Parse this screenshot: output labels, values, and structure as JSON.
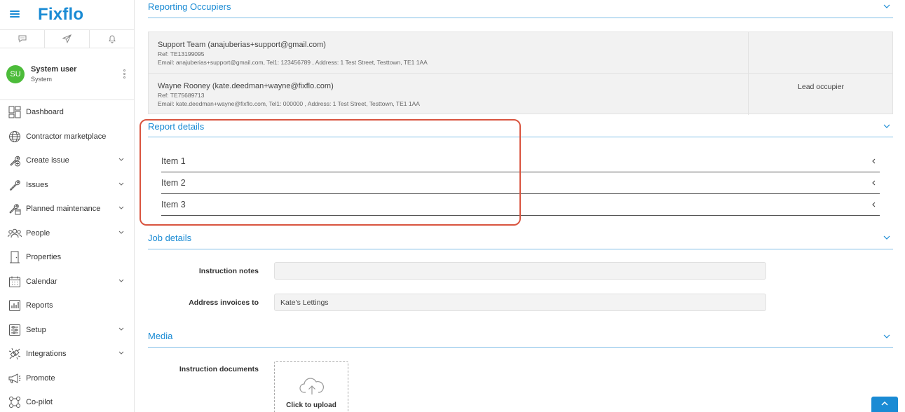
{
  "app": {
    "logo": "Fixflo"
  },
  "sidebar": {
    "top_icons": [
      "chat-icon",
      "send-icon",
      "bell-icon"
    ],
    "user": {
      "initials": "SU",
      "name": "System user",
      "role": "System",
      "avatar_color": "#4cbc3a"
    },
    "nav": [
      {
        "label": "Dashboard",
        "icon": "dashboard-icon",
        "has_chevron": false
      },
      {
        "label": "Contractor marketplace",
        "icon": "globe-icon",
        "has_chevron": false
      },
      {
        "label": "Create issue",
        "icon": "wrench-plus-icon",
        "has_chevron": true
      },
      {
        "label": "Issues",
        "icon": "wrench-icon",
        "has_chevron": true
      },
      {
        "label": "Planned maintenance",
        "icon": "calendar-wrench-icon",
        "has_chevron": true
      },
      {
        "label": "People",
        "icon": "people-icon",
        "has_chevron": true
      },
      {
        "label": "Properties",
        "icon": "door-icon",
        "has_chevron": false
      },
      {
        "label": "Calendar",
        "icon": "calendar-icon",
        "has_chevron": true
      },
      {
        "label": "Reports",
        "icon": "chart-icon",
        "has_chevron": false
      },
      {
        "label": "Setup",
        "icon": "sliders-icon",
        "has_chevron": true
      },
      {
        "label": "Integrations",
        "icon": "plug-icon",
        "has_chevron": true
      },
      {
        "label": "Promote",
        "icon": "megaphone-icon",
        "has_chevron": false
      },
      {
        "label": "Co-pilot",
        "icon": "network-icon",
        "has_chevron": false
      }
    ]
  },
  "main": {
    "reporting_occupiers": {
      "title": "Reporting Occupiers",
      "rows": [
        {
          "name": "Support Team (anajuberias+support@gmail.com)",
          "ref": "Ref: TE13199095",
          "email": "Email: anajuberias+support@gmail.com, Tel1: 123456789 , Address: 1 Test Street, Testtown, TE1 1AA",
          "status": ""
        },
        {
          "name": "Wayne Rooney (kate.deedman+wayne@fixflo.com)",
          "ref": "Ref: TE75689713",
          "email": "Email: kate.deedman+wayne@fixflo.com, Tel1: 000000 , Address: 1 Test Street, Testtown, TE1 1AA",
          "status": "Lead occupier"
        }
      ]
    },
    "report_details": {
      "title": "Report details",
      "items": [
        "Item 1",
        "Item 2",
        "Item 3"
      ]
    },
    "job_details": {
      "title": "Job details",
      "instruction_notes_label": "Instruction notes",
      "instruction_notes_value": "",
      "address_invoices_label": "Address invoices to",
      "address_invoices_value": "Kate's Lettings"
    },
    "media": {
      "title": "Media",
      "instruction_documents_label": "Instruction documents",
      "upload_text": "Click to upload"
    }
  },
  "colors": {
    "brand": "#1a8bd4",
    "highlight": "#d9543f"
  }
}
